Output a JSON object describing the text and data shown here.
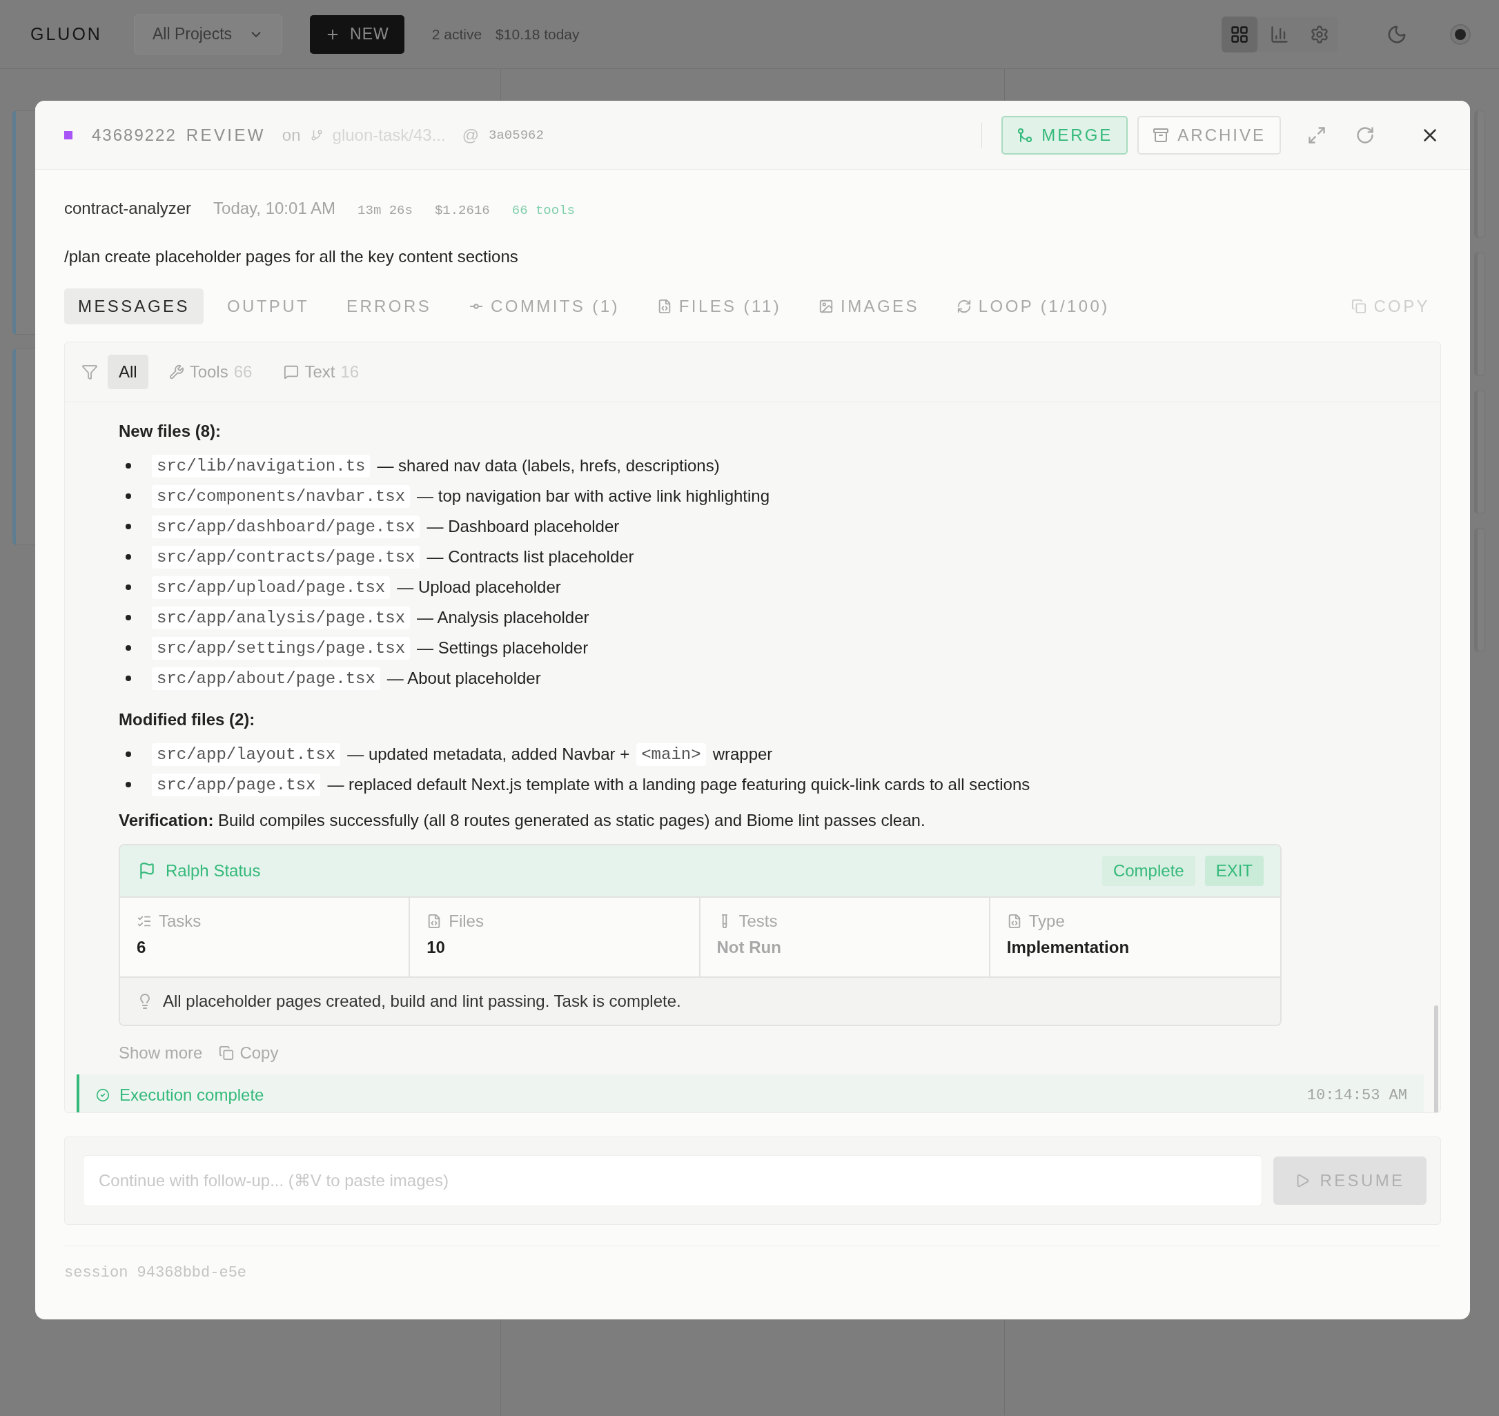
{
  "topbar": {
    "logo": "GLUON",
    "project_select": "All Projects",
    "new_button": "NEW",
    "active_count": "2 active",
    "cost": "$10.18 today",
    "view_buttons": [
      {
        "kind": "grid",
        "selected": true
      },
      {
        "kind": "chart",
        "selected": false
      },
      {
        "kind": "settings",
        "selected": false
      }
    ]
  },
  "task": {
    "id": "43689222",
    "status": "REVIEW",
    "on": "on",
    "branch": "gluon-task/43...",
    "at": "@",
    "commit": "3a05962",
    "actions": [
      {
        "kind": "merge",
        "label": "MERGE",
        "primary": true
      },
      {
        "kind": "archive",
        "label": "ARCHIVE",
        "primary": false
      }
    ]
  },
  "meta": {
    "agent": "contract-analyzer",
    "time": "Today, 10:01 AM",
    "duration": "13m 26s",
    "cost": "$1.2616",
    "tools": "66 tools"
  },
  "prompt": "/plan create placeholder pages for all the key content sections",
  "tabs": [
    {
      "label": "MESSAGES",
      "kind": "plain",
      "selected": true
    },
    {
      "label": "OUTPUT",
      "kind": "plain",
      "selected": false
    },
    {
      "label": "ERRORS",
      "kind": "plain",
      "selected": false
    },
    {
      "label": "COMMITS (1)",
      "kind": "commit",
      "selected": false
    },
    {
      "label": "FILES (11)",
      "kind": "file",
      "selected": false
    },
    {
      "label": "IMAGES",
      "kind": "image",
      "selected": false
    },
    {
      "label": "LOOP (1/100)",
      "kind": "loop",
      "selected": false
    }
  ],
  "copy_button": "COPY",
  "filters": [
    {
      "label": "All",
      "kind": "all",
      "selected": true
    },
    {
      "label": "Tools",
      "count": "66",
      "kind": "tools",
      "selected": false
    },
    {
      "label": "Text",
      "count": "16",
      "kind": "text",
      "selected": false
    }
  ],
  "message": [
    {
      "kind": "heading",
      "text": "New files (8):"
    },
    {
      "kind": "list",
      "items": [
        [
          {
            "kind": "code",
            "text": "src/lib/navigation.ts"
          },
          {
            "kind": "text",
            "text": "— shared nav data (labels, hrefs, descriptions)"
          }
        ],
        [
          {
            "kind": "code",
            "text": "src/components/navbar.tsx"
          },
          {
            "kind": "text",
            "text": "— top navigation bar with active link highlighting"
          }
        ],
        [
          {
            "kind": "code",
            "text": "src/app/dashboard/page.tsx"
          },
          {
            "kind": "text",
            "text": "— Dashboard placeholder"
          }
        ],
        [
          {
            "kind": "code",
            "text": "src/app/contracts/page.tsx"
          },
          {
            "kind": "text",
            "text": "— Contracts list placeholder"
          }
        ],
        [
          {
            "kind": "code",
            "text": "src/app/upload/page.tsx"
          },
          {
            "kind": "text",
            "text": "— Upload placeholder"
          }
        ],
        [
          {
            "kind": "code",
            "text": "src/app/analysis/page.tsx"
          },
          {
            "kind": "text",
            "text": "— Analysis placeholder"
          }
        ],
        [
          {
            "kind": "code",
            "text": "src/app/settings/page.tsx"
          },
          {
            "kind": "text",
            "text": "— Settings placeholder"
          }
        ],
        [
          {
            "kind": "code",
            "text": "src/app/about/page.tsx"
          },
          {
            "kind": "text",
            "text": "— About placeholder"
          }
        ]
      ]
    },
    {
      "kind": "heading",
      "text": "Modified files (2):"
    },
    {
      "kind": "list",
      "items": [
        [
          {
            "kind": "code",
            "text": "src/app/layout.tsx"
          },
          {
            "kind": "text",
            "text": "— updated metadata, added Navbar +"
          },
          {
            "kind": "code",
            "text": "<main>"
          },
          {
            "kind": "text",
            "text": "wrapper"
          }
        ],
        [
          {
            "kind": "code",
            "text": "src/app/page.tsx"
          },
          {
            "kind": "text",
            "text": "— replaced default Next.js template with a landing page featuring quick-link cards to all sections"
          }
        ]
      ]
    },
    {
      "kind": "paragraph",
      "text": "**Verification:** Build compiles successfully (all 8 routes generated as static pages) and Biome lint passes clean."
    }
  ],
  "ralph": {
    "title": "Ralph Status",
    "badges": [
      {
        "label": "Complete",
        "strong": false
      },
      {
        "label": "EXIT",
        "strong": true
      }
    ],
    "stats": [
      {
        "kind": "tasks",
        "label": "Tasks",
        "value": "6",
        "muted": false
      },
      {
        "kind": "file",
        "label": "Files",
        "value": "10",
        "muted": false
      },
      {
        "kind": "tests",
        "label": "Tests",
        "value": "Not Run",
        "muted": true
      },
      {
        "kind": "file",
        "label": "Type",
        "value": "Implementation",
        "muted": false
      }
    ],
    "note": "All placeholder pages created, build and lint passing. Task is complete."
  },
  "message_actions": {
    "show_more": "Show more",
    "copy": "Copy"
  },
  "execution": {
    "label": "Execution complete",
    "time": "10:14:53 AM"
  },
  "followup": {
    "placeholder": "Continue with follow-up... (⌘V to paste images)",
    "button": "RESUME"
  },
  "session": "session 94368bbd-e5e"
}
